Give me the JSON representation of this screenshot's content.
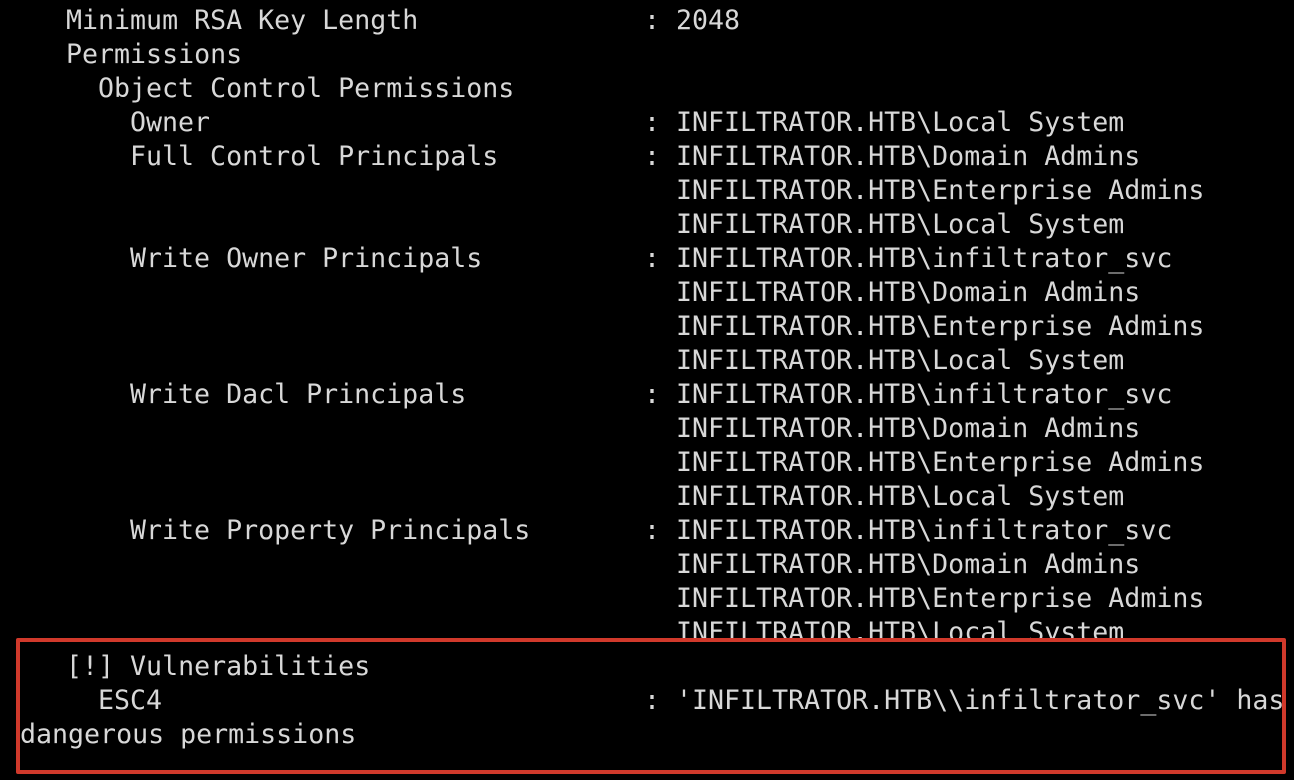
{
  "min_rsa": {
    "label": "Minimum RSA Key Length",
    "sep": ":",
    "value": "2048"
  },
  "permissions_heading": "Permissions",
  "ocp_heading": "Object Control Permissions",
  "owner": {
    "label": "Owner",
    "sep": ":",
    "value": "INFILTRATOR.HTB\\Local System"
  },
  "full_control": {
    "label": "Full Control Principals",
    "sep": ":",
    "values": [
      "INFILTRATOR.HTB\\Domain Admins",
      "INFILTRATOR.HTB\\Enterprise Admins",
      "INFILTRATOR.HTB\\Local System"
    ]
  },
  "write_owner": {
    "label": "Write Owner Principals",
    "sep": ":",
    "values": [
      "INFILTRATOR.HTB\\infiltrator_svc",
      "INFILTRATOR.HTB\\Domain Admins",
      "INFILTRATOR.HTB\\Enterprise Admins",
      "INFILTRATOR.HTB\\Local System"
    ]
  },
  "write_dacl": {
    "label": "Write Dacl Principals",
    "sep": ":",
    "values": [
      "INFILTRATOR.HTB\\infiltrator_svc",
      "INFILTRATOR.HTB\\Domain Admins",
      "INFILTRATOR.HTB\\Enterprise Admins",
      "INFILTRATOR.HTB\\Local System"
    ]
  },
  "write_property": {
    "label": "Write Property Principals",
    "sep": ":",
    "values": [
      "INFILTRATOR.HTB\\infiltrator_svc",
      "INFILTRATOR.HTB\\Domain Admins",
      "INFILTRATOR.HTB\\Enterprise Admins",
      "INFILTRATOR.HTB\\Local System"
    ]
  },
  "vulnerabilities_heading": "[!] Vulnerabilities",
  "esc4": {
    "label": "ESC4",
    "sep": ":",
    "value_line1": "'INFILTRATOR.HTB\\\\infiltrator_svc' has",
    "value_line2": "dangerous permissions"
  },
  "colors": {
    "text": "#d8d8d8",
    "background": "#000000",
    "highlight_border": "#d0392b"
  }
}
